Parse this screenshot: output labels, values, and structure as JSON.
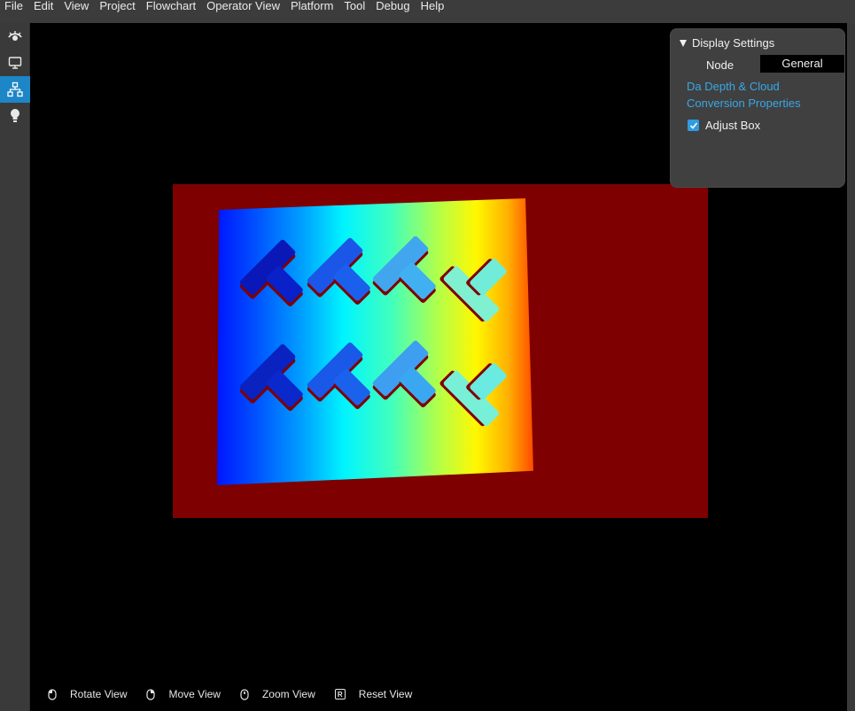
{
  "menu": [
    "File",
    "Edit",
    "View",
    "Project",
    "Flowchart",
    "Operator View",
    "Platform",
    "Tool",
    "Debug",
    "Help"
  ],
  "toolbar": {
    "tools": [
      {
        "icon": "eye-icon",
        "active": false
      },
      {
        "icon": "monitor-icon",
        "active": false
      },
      {
        "icon": "flowchart-icon",
        "active": true
      },
      {
        "icon": "lightbulb-icon",
        "active": false
      }
    ],
    "accent": "#1c86c7"
  },
  "display_settings": {
    "title": "Display Settings",
    "node_label": "Node",
    "node_value": "General",
    "link_text": "Da Depth & Cloud Conversion Properties",
    "adjust_box_label": "Adjust Box",
    "adjust_box_checked": true,
    "link_color": "#37a8e6"
  },
  "hints": {
    "rotate": "Rotate View",
    "move": "Move View",
    "zoom": "Zoom View",
    "reset": "Reset View",
    "reset_key": "R"
  },
  "depth_colors": {
    "frame": "#7f0000",
    "viewport": "#000000"
  }
}
